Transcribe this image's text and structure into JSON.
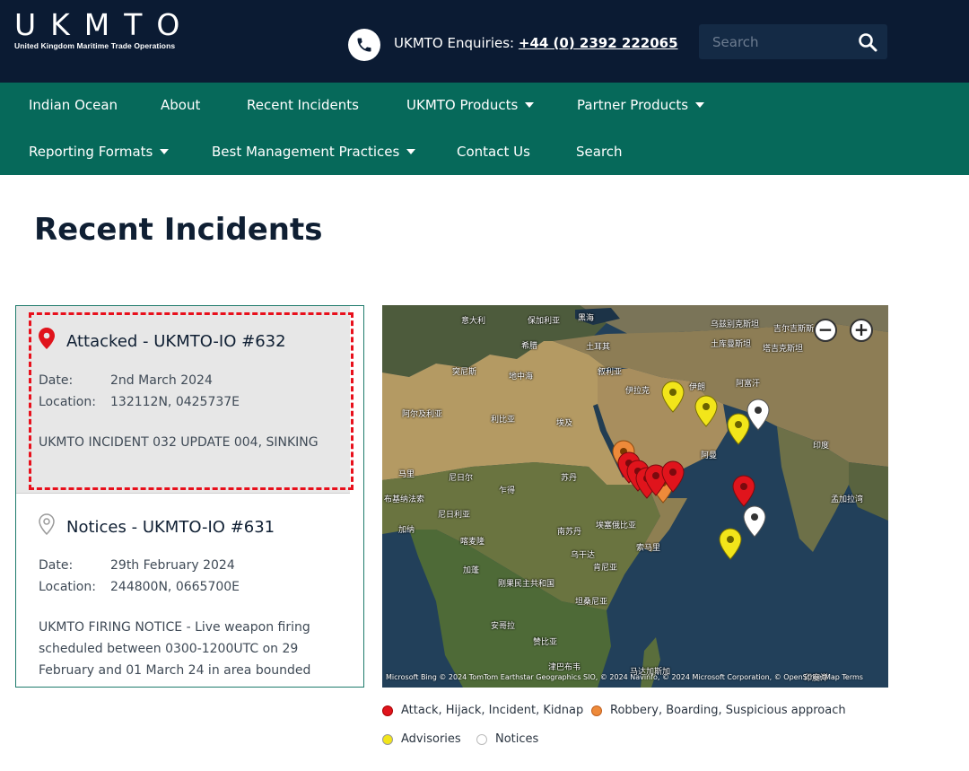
{
  "header": {
    "logo_text": "UKMTO",
    "logo_subtext": "United Kingdom Maritime Trade Operations",
    "enquiries_label": "UKMTO Enquiries:",
    "enquiries_phone": "+44 (0) 2392 222065",
    "search_placeholder": "Search"
  },
  "nav": {
    "items": [
      {
        "label": "Indian Ocean"
      },
      {
        "label": "About"
      },
      {
        "label": "Recent Incidents"
      },
      {
        "label": "UKMTO Products"
      },
      {
        "label": "Partner Products"
      },
      {
        "label": "Reporting Formats"
      },
      {
        "label": "Best Management Practices"
      },
      {
        "label": "Contact Us"
      },
      {
        "label": "Search"
      }
    ]
  },
  "page_title": "Recent Incidents",
  "incidents": [
    {
      "title": "Attacked - UKMTO-IO #632",
      "date_label": "Date:",
      "date": "2nd March 2024",
      "location_label": "Location:",
      "location": "132112N, 0425737E",
      "description": "UKMTO INCIDENT 032 UPDATE 004, SINKING",
      "pin_color": "#e0141c"
    },
    {
      "title": "Notices - UKMTO-IO #631",
      "date_label": "Date:",
      "date": "29th February 2024",
      "location_label": "Location:",
      "location": "244800N, 0665700E",
      "description": "UKMTO FIRING NOTICE - Live weapon firing scheduled between 0300-1200UTC on 29 February and 01 March 24 in area bounded",
      "pin_color": "#9a9a9a"
    }
  ],
  "map": {
    "labels": [
      "意大利",
      "保加利亚",
      "黑海",
      "乌兹别克斯坦",
      "吉尔吉斯斯",
      "希腊",
      "土耳其",
      "土库曼斯坦",
      "塔吉克斯坦",
      "突尼斯",
      "地中海",
      "叙利亚",
      "伊拉克",
      "伊朗",
      "阿富汗",
      "阿尔及利亚",
      "利比亚",
      "埃及",
      "印度",
      "阿曼",
      "马里",
      "尼日尔",
      "苏丹",
      "孟加拉湾",
      "布基纳法索",
      "乍得",
      "尼日利亚",
      "埃塞俄比亚",
      "加纳",
      "喀麦隆",
      "南苏丹",
      "索马里",
      "加蓬",
      "乌干达",
      "肯尼亚",
      "刚果民主共和国",
      "坦桑尼亚",
      "安哥拉",
      "赞比亚",
      "津巴布韦",
      "马达加斯加",
      "印度洋"
    ],
    "zoom_out": "−",
    "zoom_in": "+",
    "copyright": "Microsoft Bing  © 2024 TomTom  Earthstar Geographics SIO, © 2024 Navinfo, © 2024 Microsoft Corporation, © OpenStreetMap  Terms"
  },
  "legend": [
    {
      "label": "Attack, Hijack, Incident, Kidnap",
      "color": "#e0141c"
    },
    {
      "label": "Robbery, Boarding, Suspicious approach",
      "color": "#ee8a3a"
    },
    {
      "label": "Advisories",
      "color": "#f2e51a"
    },
    {
      "label": "Notices",
      "color": "#ffffff"
    }
  ]
}
